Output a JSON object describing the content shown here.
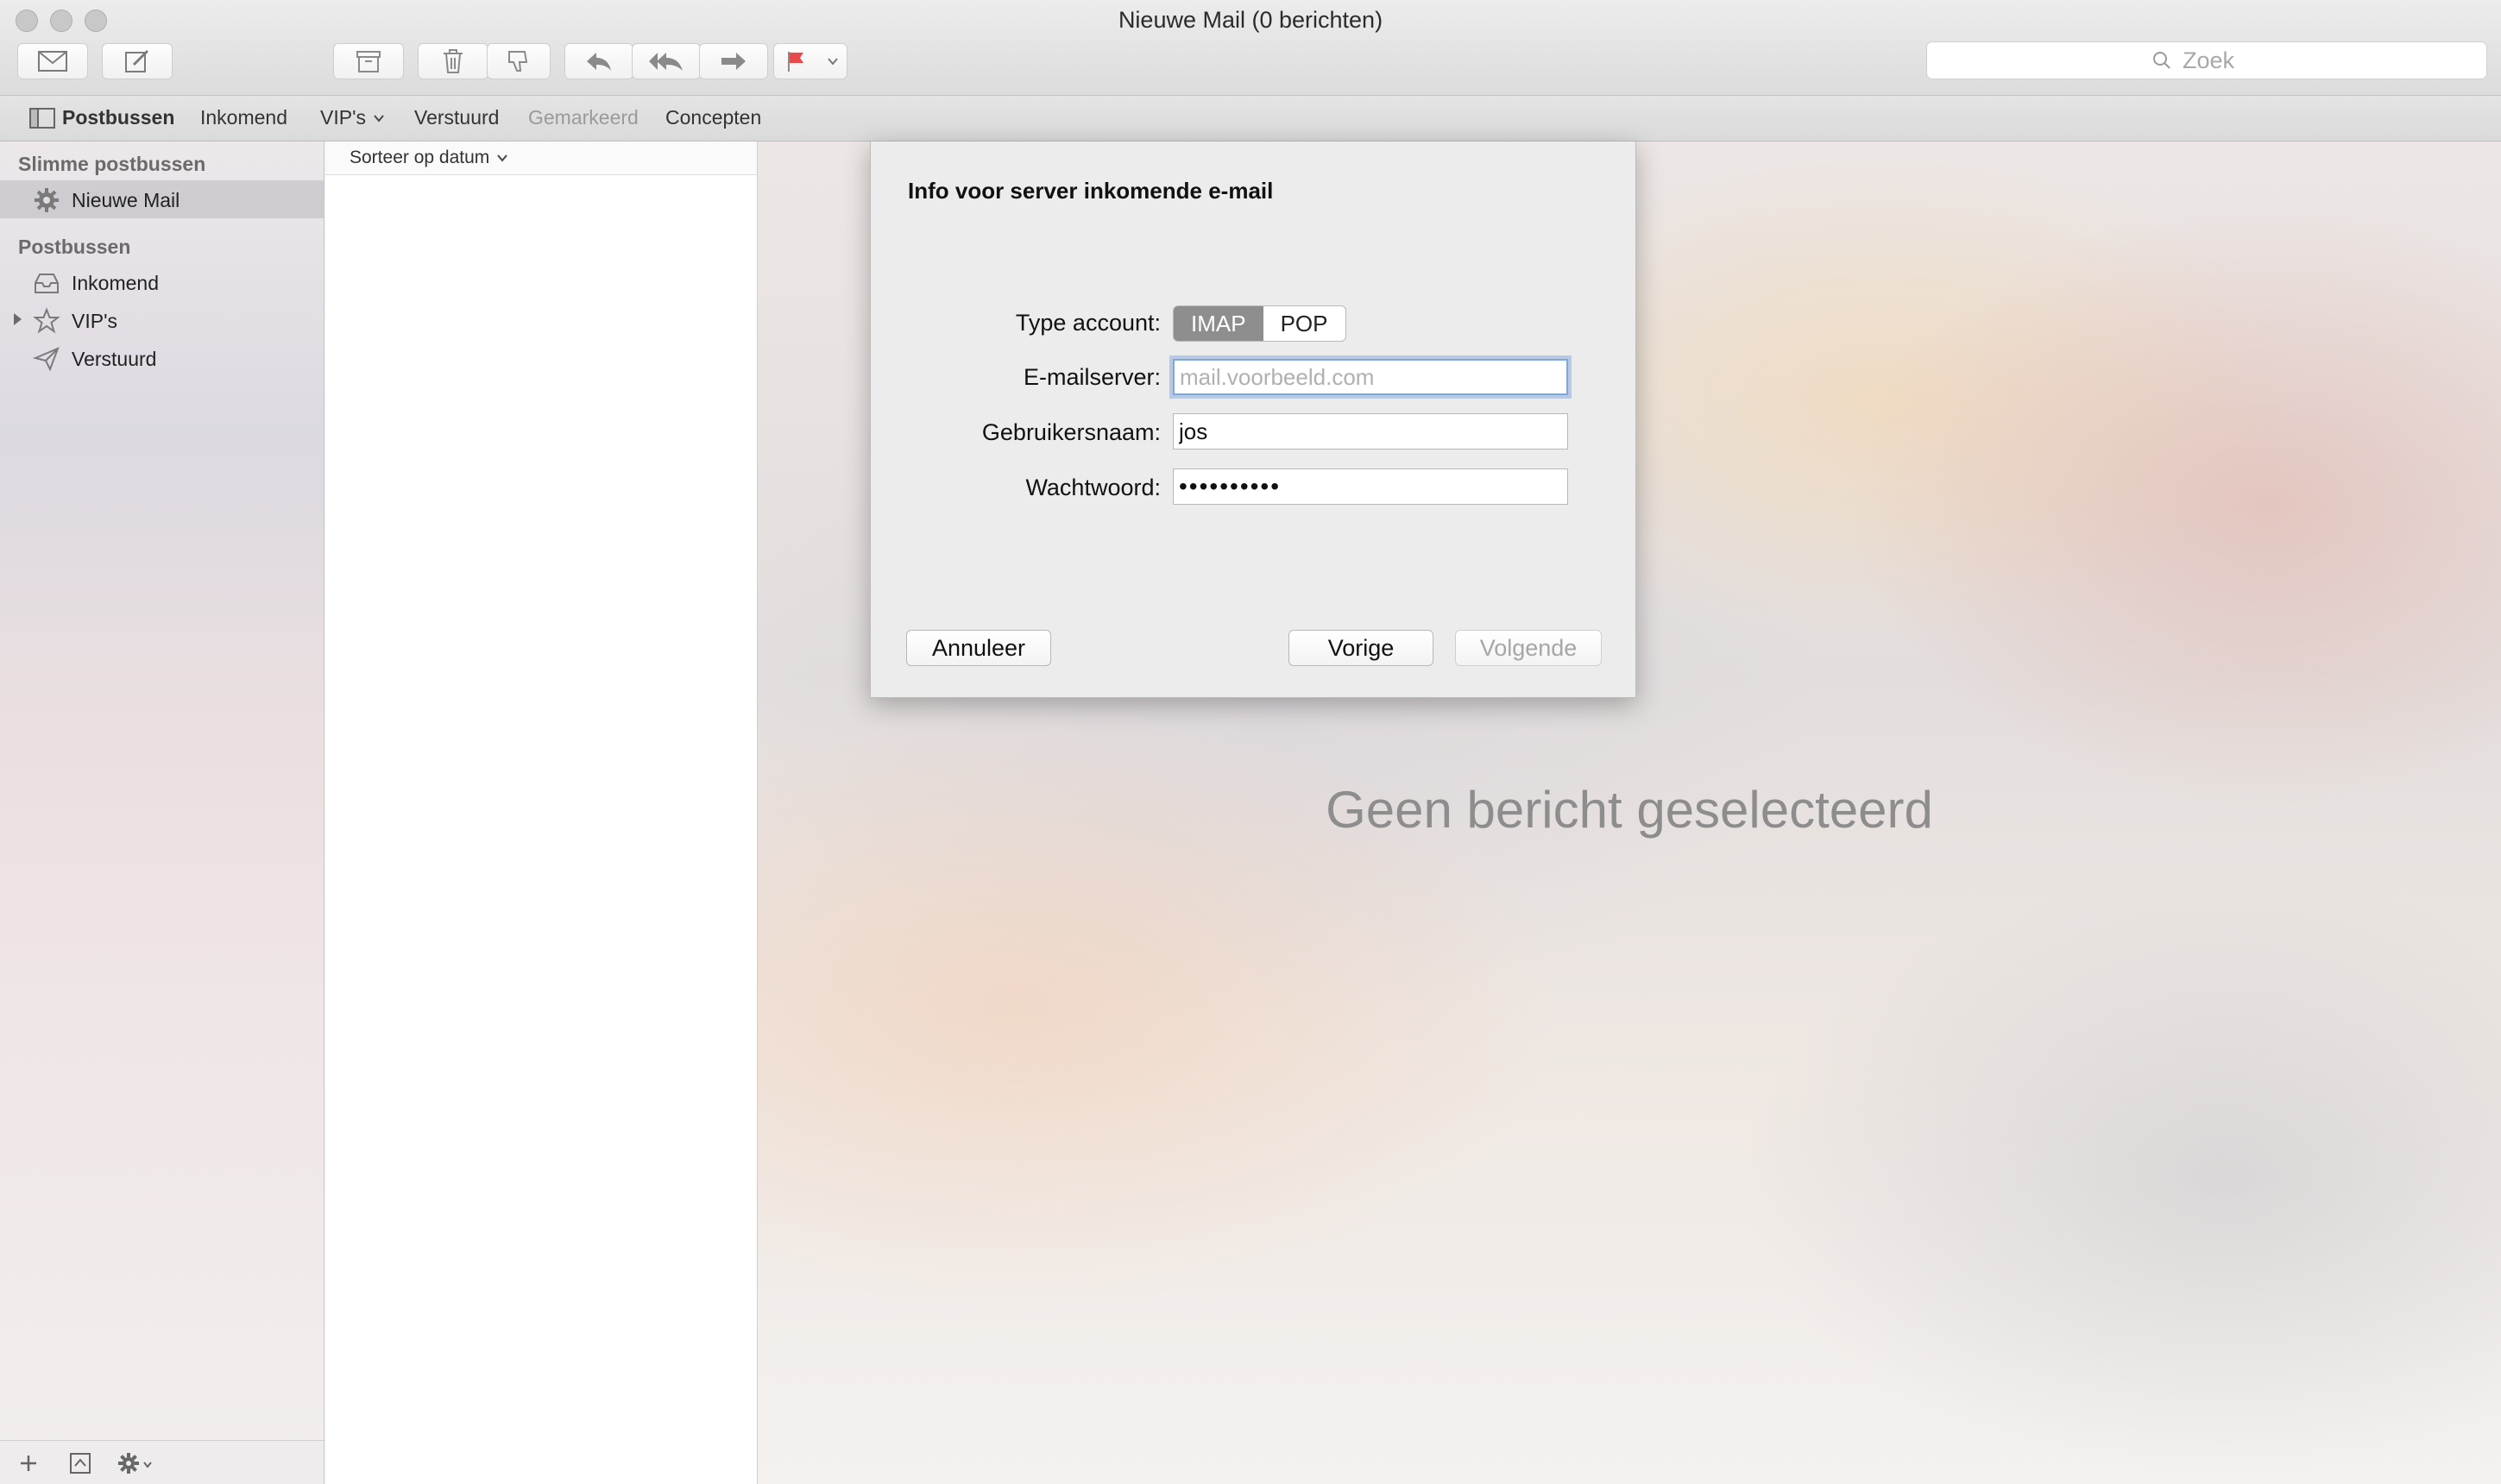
{
  "window": {
    "title": "Nieuwe Mail (0 berichten)"
  },
  "toolbar": {
    "buttons": [
      {
        "name": "get-mail",
        "icon": "envelope-icon"
      },
      {
        "name": "compose",
        "icon": "compose-icon"
      },
      {
        "name": "archive",
        "icon": "archive-icon"
      },
      {
        "name": "delete",
        "icon": "trash-icon"
      },
      {
        "name": "junk",
        "icon": "thumbs-down-icon"
      },
      {
        "name": "reply",
        "icon": "reply-icon"
      },
      {
        "name": "reply-all",
        "icon": "reply-all-icon"
      },
      {
        "name": "forward",
        "icon": "forward-icon"
      },
      {
        "name": "flag",
        "icon": "flag-icon",
        "color": "#e8494b"
      }
    ],
    "search_placeholder": "Zoek"
  },
  "favorites": {
    "mailboxes_label": "Postbussen",
    "inbox_label": "Inkomend",
    "vips_label": "VIP's",
    "sent_label": "Verstuurd",
    "flagged_label": "Gemarkeerd",
    "drafts_label": "Concepten"
  },
  "sidebar": {
    "smart_heading": "Slimme postbussen",
    "smart_items": [
      {
        "label": "Nieuwe Mail",
        "icon": "gear-icon",
        "selected": true
      }
    ],
    "mailboxes_heading": "Postbussen",
    "mailbox_items": [
      {
        "label": "Inkomend",
        "icon": "inbox-tray-icon"
      },
      {
        "label": "VIP's",
        "icon": "star-icon"
      },
      {
        "label": "Verstuurd",
        "icon": "paper-plane-icon"
      }
    ]
  },
  "message_list": {
    "sort_label": "Sorteer op datum"
  },
  "viewer": {
    "empty_text": "Geen bericht geselecteerd"
  },
  "dialog": {
    "title": "Info voor server inkomende e-mail",
    "account_type_label": "Type account:",
    "account_types": [
      "IMAP",
      "POP"
    ],
    "selected_account_type": "IMAP",
    "server_label": "E-mailserver:",
    "server_placeholder": "mail.voorbeeld.com",
    "server_value": "",
    "username_label": "Gebruikersnaam:",
    "username_value": "jos",
    "password_label": "Wachtwoord:",
    "password_value": "••••••••••",
    "cancel_label": "Annuleer",
    "back_label": "Vorige",
    "next_label": "Volgende"
  }
}
